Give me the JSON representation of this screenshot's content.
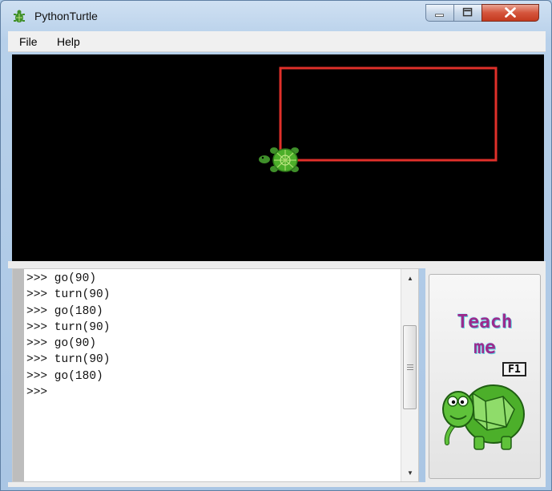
{
  "window": {
    "title": "PythonTurtle"
  },
  "menu": [
    {
      "label": "File"
    },
    {
      "label": "Help"
    }
  ],
  "canvas": {
    "background": "#000000",
    "pen_color": "#e0302a",
    "turtle_color": "#4caf2a"
  },
  "console": {
    "lines": [
      ">>> go(90)",
      ">>> turn(90)",
      ">>> go(180)",
      ">>> turn(90)",
      ">>> go(90)",
      ">>> turn(90)",
      ">>> go(180)",
      ">>> "
    ]
  },
  "teach": {
    "line1": "Teach",
    "line2": "me",
    "shortcut": "F1"
  }
}
